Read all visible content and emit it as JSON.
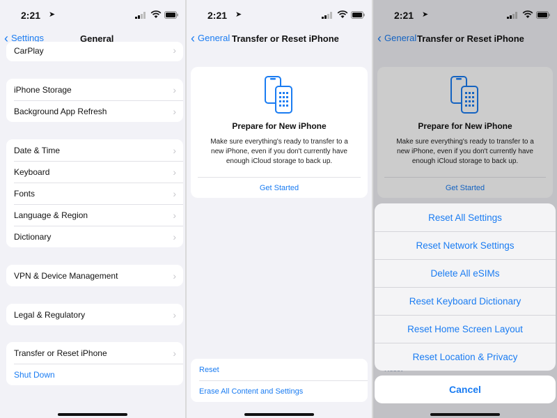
{
  "status": {
    "time": "2:21",
    "loc_arrow": "➤"
  },
  "screen1": {
    "back": "Settings",
    "title": "General",
    "group0": [
      "CarPlay"
    ],
    "group1": [
      "iPhone Storage",
      "Background App Refresh"
    ],
    "group2": [
      "Date & Time",
      "Keyboard",
      "Fonts",
      "Language & Region",
      "Dictionary"
    ],
    "group3": [
      "VPN & Device Management"
    ],
    "group4": [
      "Legal & Regulatory"
    ],
    "group5": [
      "Transfer or Reset iPhone",
      "Shut Down"
    ]
  },
  "screen2": {
    "back": "General",
    "title": "Transfer or Reset iPhone",
    "card": {
      "title": "Prepare for New iPhone",
      "desc": "Make sure everything's ready to transfer to a new iPhone, even if you don't currently have enough iCloud storage to back up.",
      "button": "Get Started"
    },
    "bottom": [
      "Reset",
      "Erase All Content and Settings"
    ]
  },
  "screen3": {
    "options": [
      "Reset All Settings",
      "Reset Network Settings",
      "Delete All eSIMs",
      "Reset Keyboard Dictionary",
      "Reset Home Screen Layout",
      "Reset Location & Privacy"
    ],
    "cancel": "Cancel",
    "peek": "Reset"
  },
  "colors": {
    "accent": "#1a7cf2",
    "background": "#f2f2f7"
  }
}
